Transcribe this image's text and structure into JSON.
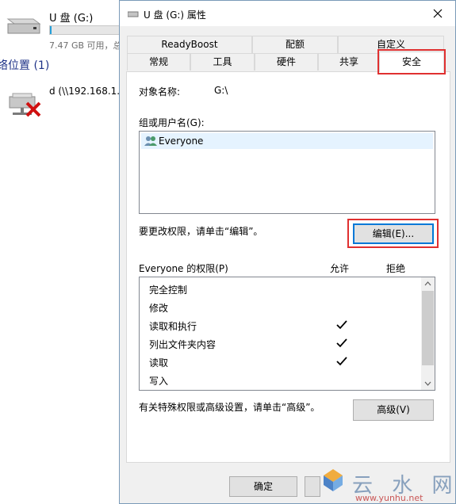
{
  "explorer": {
    "drive_name": "U 盘 (G:)",
    "drive_free": "7.47 GB 可用，总",
    "drive_usage_fraction": 0.02,
    "section_header": "络位置 (1)",
    "network_item": "d (\\\\192.168.1.1"
  },
  "dialog": {
    "title": "U 盘 (G:) 属性",
    "tabs_back": [
      "ReadyBoost",
      "配额",
      "自定义"
    ],
    "tabs_front": [
      "常规",
      "工具",
      "硬件",
      "共享",
      "安全"
    ],
    "active_tab": "安全",
    "object_name_label": "对象名称:",
    "object_name_value": "G:\\",
    "group_label": "组或用户名(G):",
    "users": [
      "Everyone"
    ],
    "edit_hint": "要更改权限，请单击“编辑”。",
    "edit_button": "编辑(E)...",
    "permissions_label": "Everyone 的权限(P)",
    "allow_header": "允许",
    "deny_header": "拒绝",
    "permissions": [
      {
        "name": "完全控制",
        "allow": false
      },
      {
        "name": "修改",
        "allow": false
      },
      {
        "name": "读取和执行",
        "allow": true
      },
      {
        "name": "列出文件夹内容",
        "allow": true
      },
      {
        "name": "读取",
        "allow": true
      },
      {
        "name": "写入",
        "allow": false
      }
    ],
    "advanced_hint": "有关特殊权限或高级设置，请单击“高级”。",
    "advanced_button": "高级(V)",
    "ok_button": "确定"
  },
  "colors": {
    "highlight": "#e03030",
    "accent": "#0078d7",
    "selection": "#e5f3ff"
  },
  "watermark": {
    "text": "云 水 网",
    "url": "www.yunhu.net"
  }
}
